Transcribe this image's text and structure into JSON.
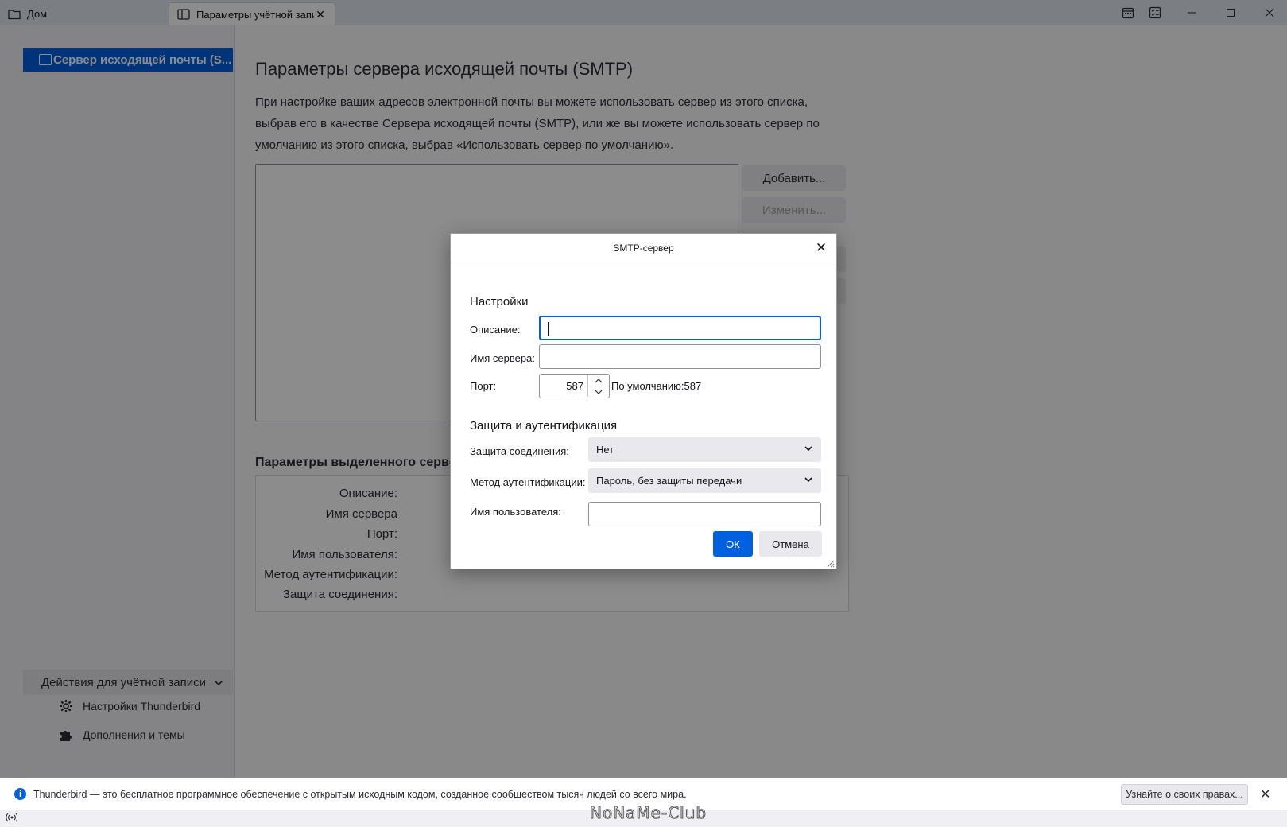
{
  "tabs": [
    {
      "label": "Дом",
      "icon": "folder-icon"
    },
    {
      "label": "Параметры учётной записи",
      "icon": "account-settings-icon"
    }
  ],
  "sidebar": {
    "account_item": "Сервер исходящей почты (S...",
    "account_actions": "Действия для учётной записи",
    "links": [
      {
        "label": "Настройки Thunderbird",
        "icon": "gear-icon"
      },
      {
        "label": "Дополнения и темы",
        "icon": "puzzle-icon"
      }
    ]
  },
  "main": {
    "title": "Параметры сервера исходящей почты (SMTP)",
    "description": "При настройке ваших адресов электронной почты вы можете использовать сервер из этого списка, выбрав его в качестве Сервера исходящей почты (SMTP), или же вы можете использовать сервер по умолчанию из этого списка, выбрав «Использовать сервер по умолчанию».",
    "buttons": {
      "add": "Добавить...",
      "edit": "Изменить..."
    },
    "selected_title": "Параметры выделенного сервера",
    "selected_rows": [
      "Описание:",
      "Имя сервера",
      "Порт:",
      "Имя пользователя:",
      "Метод аутентификации:",
      "Защита соединения:"
    ]
  },
  "dialog": {
    "title": "SMTP-сервер",
    "settings_heading": "Настройки",
    "description_label": "Описание:",
    "description_value": "",
    "server_label": "Имя сервера:",
    "server_value": "",
    "port_label": "Порт:",
    "port_value": "587",
    "port_default": "По умолчанию:587",
    "security_heading": "Защита и аутентификация",
    "connection_security_label": "Защита соединения:",
    "connection_security_value": "Нет",
    "auth_method_label": "Метод аутентификации:",
    "auth_method_value": "Пароль, без защиты передачи",
    "username_label": "Имя пользователя:",
    "username_value": "",
    "ok": "ОК",
    "cancel": "Отмена"
  },
  "notification": {
    "text": "Thunderbird — это бесплатное программное обеспечение с открытым исходным кодом, созданное сообществом тысяч людей со всего мира.",
    "button": "Узнайте о своих правах..."
  },
  "watermark": "NoNaMe-Club",
  "colors": {
    "accent": "#0060df",
    "overlay": "rgba(0,0,0,0.45)"
  }
}
